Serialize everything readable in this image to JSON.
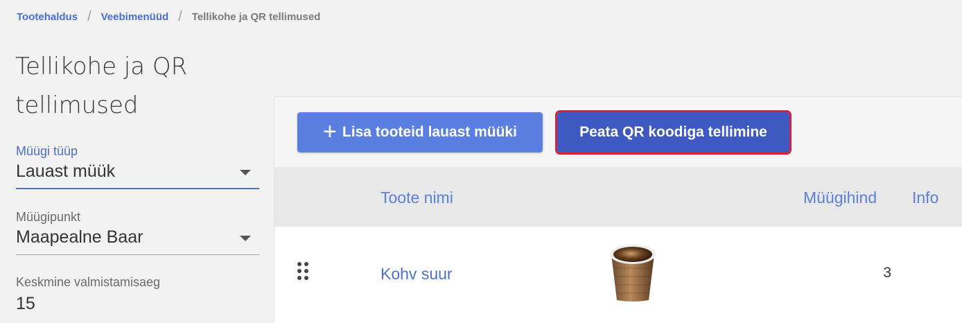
{
  "breadcrumb": {
    "items": [
      "Tootehaldus",
      "Veebimenüüd"
    ],
    "separator": "/",
    "current": "Tellikohe ja QR tellimused"
  },
  "page": {
    "title": "Tellikohe ja QR tellimused"
  },
  "filters": {
    "sale_type": {
      "label": "Müügi tüüp",
      "value": "Lauast müük"
    },
    "sale_point": {
      "label": "Müügipunkt",
      "value": "Maapealne Baar"
    },
    "prep_time": {
      "label": "Keskmine valmistamisaeg",
      "value": "15"
    }
  },
  "toolbar": {
    "add_label": "Lisa tooteid lauast müüki",
    "add_icon": "plus-icon",
    "qr_label": "Peata QR koodiga tellimine"
  },
  "table": {
    "headers": {
      "name": "Toote nimi",
      "price": "Müügihind",
      "info": "Info"
    },
    "rows": [
      {
        "name": "Kohv suur",
        "image": "coffee-cup-image",
        "price": "3"
      }
    ]
  },
  "colors": {
    "accent": "#5b7fe0",
    "primary_dark": "#3e5ac2",
    "highlight": "#d6213a"
  }
}
